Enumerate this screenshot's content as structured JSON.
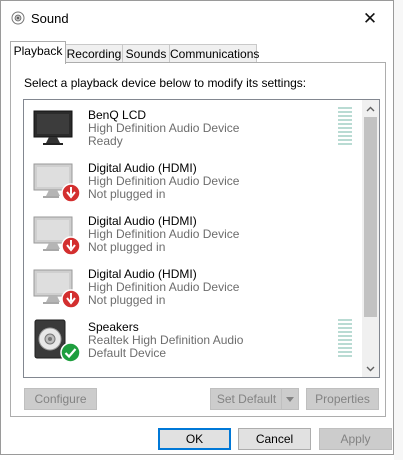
{
  "window": {
    "title": "Sound",
    "close_glyph": "✕"
  },
  "tabs": [
    {
      "label": "Playback",
      "active": true
    },
    {
      "label": "Recording",
      "active": false
    },
    {
      "label": "Sounds",
      "active": false
    },
    {
      "label": "Communications",
      "active": false
    }
  ],
  "playback": {
    "instruction": "Select a playback device below to modify its settings:",
    "devices": [
      {
        "name": "BenQ LCD",
        "description": "High Definition Audio Device",
        "status": "Ready",
        "icon": "monitor-icon",
        "badge": null
      },
      {
        "name": "Digital Audio (HDMI)",
        "description": "High Definition Audio Device",
        "status": "Not plugged in",
        "icon": "monitor-icon",
        "badge": "unplugged-badge-icon"
      },
      {
        "name": "Digital Audio (HDMI)",
        "description": "High Definition Audio Device",
        "status": "Not plugged in",
        "icon": "monitor-icon",
        "badge": "unplugged-badge-icon"
      },
      {
        "name": "Digital Audio (HDMI)",
        "description": "High Definition Audio Device",
        "status": "Not plugged in",
        "icon": "monitor-icon",
        "badge": "unplugged-badge-icon"
      },
      {
        "name": "Speakers",
        "description": "Realtek High Definition Audio",
        "status": "Default Device",
        "icon": "speaker-icon",
        "badge": "default-check-icon"
      }
    ],
    "buttons": {
      "configure": "Configure",
      "set_default": "Set Default",
      "properties": "Properties"
    }
  },
  "footer": {
    "ok": "OK",
    "cancel": "Cancel",
    "apply": "Apply"
  },
  "colors": {
    "accent": "#0078d7",
    "unplugged_badge": "#d32f2f",
    "default_badge": "#1e9e3e",
    "level_meter": "#b9dbd3"
  }
}
